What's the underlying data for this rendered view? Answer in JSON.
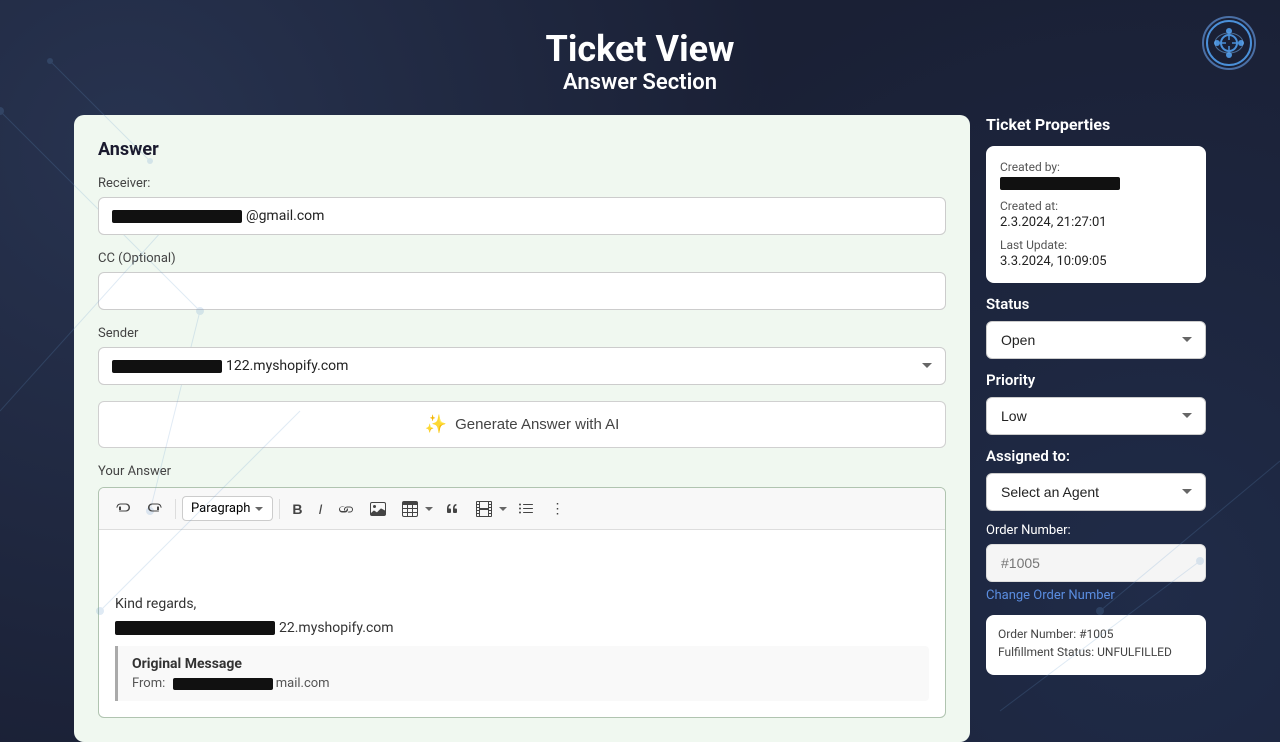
{
  "header": {
    "title": "Ticket View",
    "subtitle": "Answer Section"
  },
  "answer_section": {
    "section_title": "Answer",
    "receiver_label": "Receiver:",
    "receiver_value": "••••••••••@gmail.com",
    "cc_label": "CC (Optional)",
    "cc_placeholder": "",
    "sender_label": "Sender",
    "sender_value": "•••••••••••• 122.myshopify.com",
    "ai_button_label": "Generate Answer with AI",
    "your_answer_label": "Your Answer",
    "toolbar": {
      "paragraph_label": "Paragraph",
      "bold": "B",
      "italic": "I",
      "undo": "↩",
      "redo": "↪"
    },
    "editor_content": {
      "kind_regards": "Kind regards,",
      "signature": "•••••••••••• 22.myshopify.com",
      "original_message_title": "Original Message",
      "original_message_from": "From:"
    }
  },
  "ticket_properties": {
    "section_title": "Ticket Properties",
    "created_by_label": "Created by:",
    "created_by_value": "████████████",
    "created_at_label": "Created at:",
    "created_at_value": "2.3.2024, 21:27:01",
    "last_update_label": "Last Update:",
    "last_update_value": "3.3.2024, 10:09:05",
    "status_label": "Status",
    "status_value": "Open",
    "priority_label": "Priority",
    "priority_value": "Low",
    "assigned_to_label": "Assigned to:",
    "assigned_to_placeholder": "Select an Agent",
    "order_number_label": "Order Number:",
    "order_number_placeholder": "#1005",
    "change_order_link": "Change Order Number",
    "order_details": {
      "order_number": "Order Number: #1005",
      "fulfillment_status": "Fulfillment Status: UNFULFILLED"
    }
  }
}
